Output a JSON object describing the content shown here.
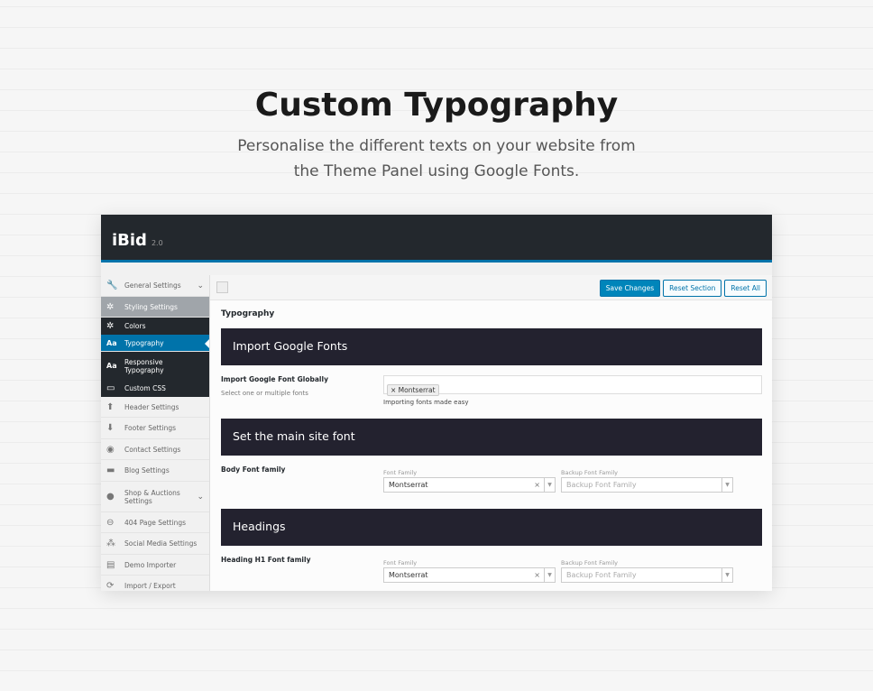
{
  "hero": {
    "title": "Custom Typography",
    "subtitle_1": "Personalise the different texts on your website from",
    "subtitle_2": "the Theme Panel using Google Fonts."
  },
  "app": {
    "name": "iBid",
    "version": "2.0"
  },
  "sidebar": {
    "items": [
      {
        "label": "General Settings",
        "icon": "wrench-icon",
        "state": "normal",
        "chevron": true
      },
      {
        "label": "Styling Settings",
        "icon": "magic-wand-icon",
        "state": "gray"
      },
      {
        "label": "Colors",
        "icon": "magic-wand-icon",
        "state": "dark"
      },
      {
        "label": "Typography",
        "icon": "font-icon",
        "state": "active"
      },
      {
        "label": "Responsive Typography",
        "icon": "font-icon",
        "state": "dark"
      },
      {
        "label": "Custom CSS",
        "icon": "css-icon",
        "state": "dark"
      },
      {
        "label": "Header Settings",
        "icon": "arrow-up-icon",
        "state": "normal"
      },
      {
        "label": "Footer Settings",
        "icon": "arrow-down-icon",
        "state": "normal"
      },
      {
        "label": "Contact Settings",
        "icon": "location-icon",
        "state": "normal"
      },
      {
        "label": "Blog Settings",
        "icon": "comment-icon",
        "state": "normal"
      },
      {
        "label": "Shop & Auctions Settings",
        "icon": "cart-icon",
        "state": "normal",
        "chevron": true
      },
      {
        "label": "404 Page Settings",
        "icon": "minus-circle-icon",
        "state": "normal"
      },
      {
        "label": "Social Media Settings",
        "icon": "groups-icon",
        "state": "normal"
      },
      {
        "label": "Demo Importer",
        "icon": "calculator-icon",
        "state": "normal"
      },
      {
        "label": "Import / Export",
        "icon": "refresh-icon",
        "state": "normal"
      }
    ]
  },
  "toolbar": {
    "save": "Save Changes",
    "reset_section": "Reset Section",
    "reset_all": "Reset All"
  },
  "main": {
    "heading": "Typography",
    "sec1": {
      "title": "Import Google Fonts",
      "label": "Import Google Font Globally",
      "desc": "Select one or multiple fonts",
      "tag": "Montserrat",
      "note": "Importing fonts made easy"
    },
    "sec2": {
      "title": "Set the main site font",
      "label": "Body Font family",
      "font_label": "Font Family",
      "font_value": "Montserrat",
      "backup_label": "Backup Font Family",
      "backup_placeholder": "Backup Font Family"
    },
    "sec3": {
      "title": "Headings",
      "label": "Heading H1 Font family",
      "font_label": "Font Family",
      "font_value": "Montserrat",
      "backup_label": "Backup Font Family",
      "backup_placeholder": "Backup Font Family"
    }
  }
}
